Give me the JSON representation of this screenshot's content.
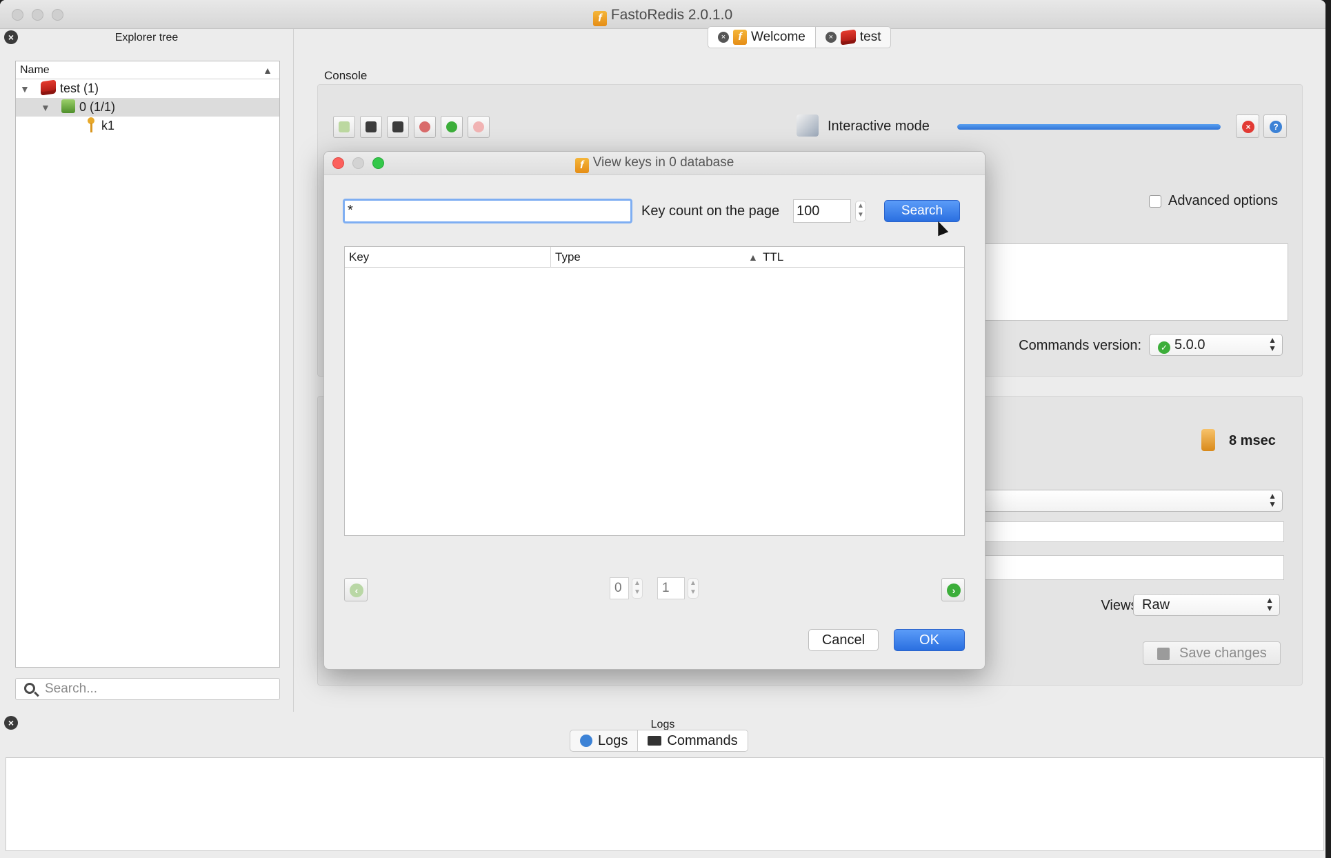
{
  "window": {
    "title": "FastoRedis 2.0.1.0"
  },
  "explorer": {
    "title": "Explorer tree",
    "column_name": "Name",
    "items": [
      {
        "label": "test (1)",
        "icon": "redis-server-icon"
      },
      {
        "label": "0 (1/1)",
        "icon": "database-icon"
      },
      {
        "label": "k1",
        "icon": "key-icon"
      }
    ],
    "search_placeholder": "Search..."
  },
  "tabs": [
    {
      "label": "Welcome"
    },
    {
      "label": "test"
    }
  ],
  "console": {
    "label": "Console",
    "interactive_mode": "Interactive mode",
    "progress": 1.0,
    "advanced_options": "Advanced options",
    "commands_version_label": "Commands version:",
    "commands_version_value": "5.0.0",
    "exec_time": "8 msec",
    "views_label": "Views:",
    "views_value": "Raw",
    "save_changes": "Save changes"
  },
  "logs": {
    "title": "Logs",
    "tabs": [
      {
        "label": "Logs"
      },
      {
        "label": "Commands"
      }
    ]
  },
  "dialog": {
    "title": "View keys in 0 database",
    "pattern_value": "*",
    "key_count_label": "Key count on the page",
    "key_count_value": "100",
    "search_label": "Search",
    "columns": [
      "Key",
      "Type",
      "TTL"
    ],
    "page_current": "0",
    "page_total": "1",
    "cancel_label": "Cancel",
    "ok_label": "OK"
  },
  "colors": {
    "accent": "#2f73d6",
    "danger": "#e23a34"
  }
}
